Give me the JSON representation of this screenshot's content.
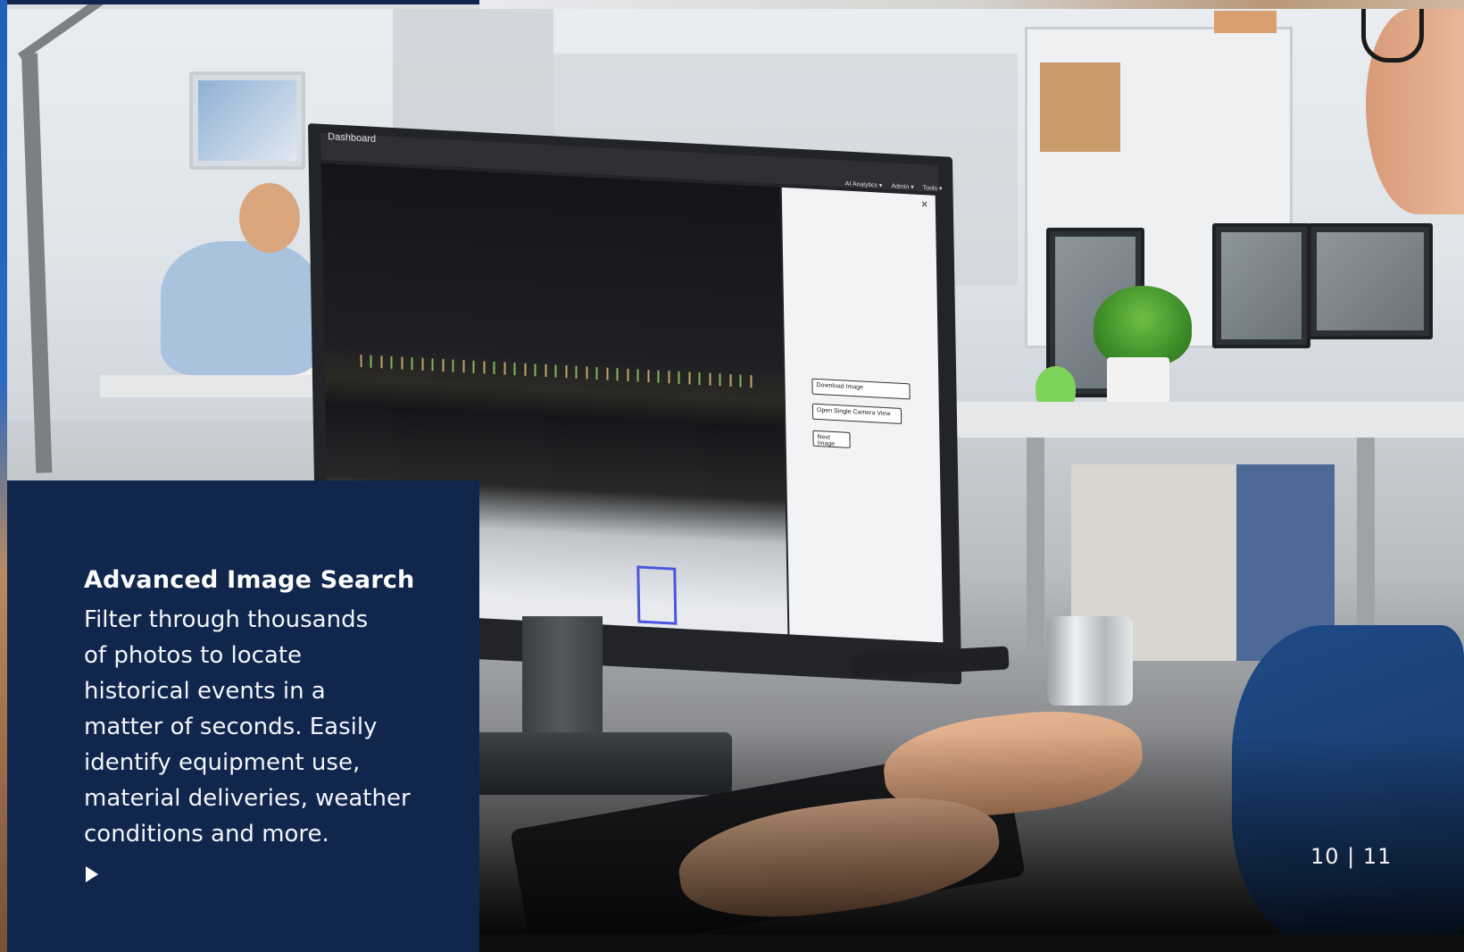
{
  "feature": {
    "title": "Advanced Image Search",
    "description_lines": [
      "Filter through thousands",
      "of photos to locate",
      "historical events in a",
      "matter of seconds. Easily",
      "identify equipment use,",
      "material deliveries, weather",
      "conditions and more."
    ],
    "action_icon": "play-arrow-icon"
  },
  "page_numbers": "10 | 11",
  "monitor_screen": {
    "title": "Dashboard",
    "menu": [
      "AI Analytics ▾",
      "Admin ▾",
      "Tools ▾"
    ],
    "buttons": {
      "download": "Download Image",
      "open_single": "Open Single Camera View",
      "next": "Next Image"
    },
    "close_icon": "close-icon"
  },
  "colors": {
    "card_background": "#10264d",
    "accent_blue": "#1f5fb5",
    "detection_box": "#4a56e0"
  }
}
